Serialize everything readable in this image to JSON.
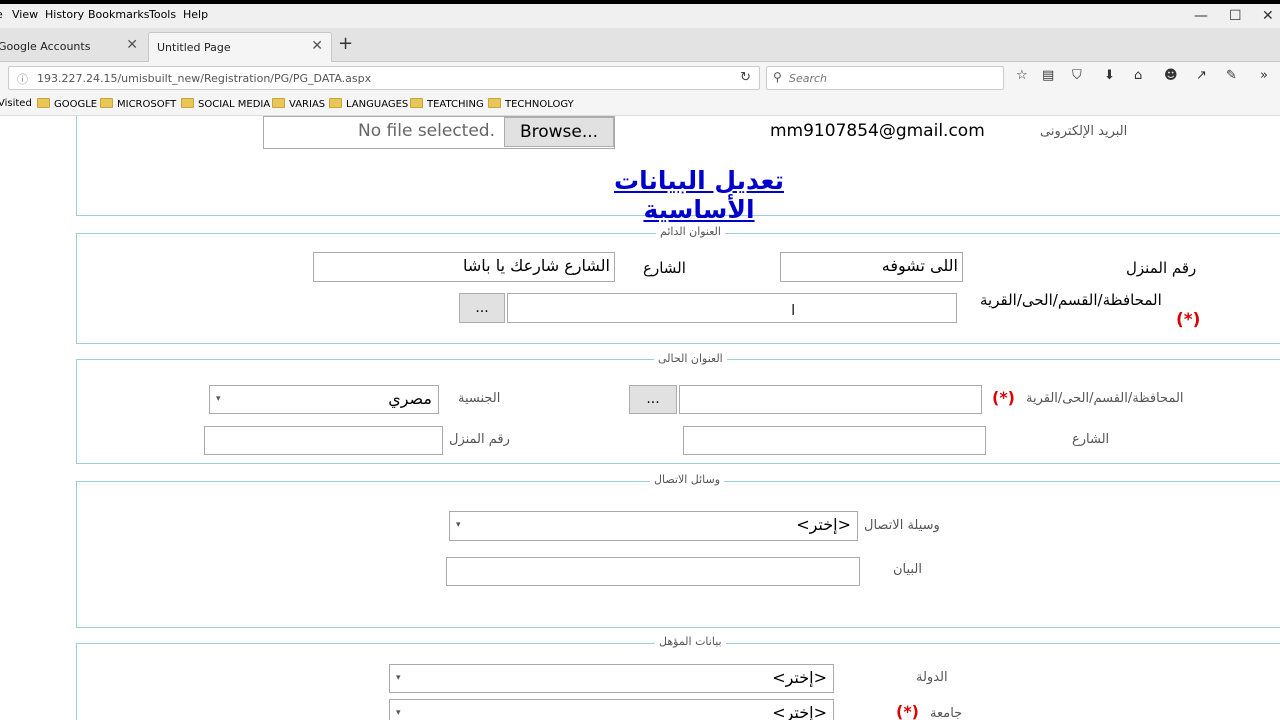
{
  "menu": {
    "items": [
      "View",
      "History",
      "Bookmarks",
      "Tools",
      "Help"
    ]
  },
  "tabs": [
    {
      "label": "Google Accounts"
    },
    {
      "label": "Untitled Page"
    }
  ],
  "url": "193.227.24.15/umisbuilt_new/Registration/PG/PG_DATA.aspx",
  "search_placeholder": "Search",
  "bookmarks": [
    "Visited",
    "GOOGLE",
    "MICROSOFT",
    "SOCIAL MEDIA",
    "VARIAS",
    "LANGUAGES",
    "TEATCHING",
    "TECHNOLOGY"
  ],
  "top_section": {
    "file_status": "No file selected.",
    "browse_label": "Browse...",
    "email_value": "mm9107854@gmail.com",
    "email_label": "البريد الإلكترونى",
    "title_link": "تعديل البيانات الأساسية"
  },
  "permanent_address": {
    "legend": "العنوان الدائم",
    "house_label": "رقم المنزل",
    "house_value": "اللى تشوفه",
    "street_label": "الشارع",
    "street_value": "الشارع شارعك يا باشا",
    "governorate_label": "المحافظة/القسم/الحى/القرية",
    "required_mark": "(*)",
    "picker_label": "...",
    "governorate_value": ""
  },
  "current_address": {
    "legend": "العنوان الحالى",
    "governorate_label": "المحافظة/القسم/الحى/القرية",
    "required_mark": "(*)",
    "picker_label": "...",
    "governorate_value": "",
    "nationality_label": "الجنسية",
    "nationality_value": "مصري",
    "street_label": "الشارع",
    "street_value": "",
    "house_label": "رقم المنزل",
    "house_value": ""
  },
  "contact": {
    "legend": "وسائل الاتصال",
    "method_label": "وسيلة الاتصال",
    "method_value": "<إختر>",
    "data_label": "البيان",
    "data_value": ""
  },
  "qualification": {
    "legend": "بيانات المؤهل",
    "country_label": "الدولة",
    "country_value": "<إختر>",
    "university_label": "جامعة",
    "required_mark": "(*)",
    "university_value": "<إختر>"
  },
  "colors": {
    "panel_border": "#9ad0d8",
    "link": "#0000cc",
    "required": "#dd0000"
  }
}
